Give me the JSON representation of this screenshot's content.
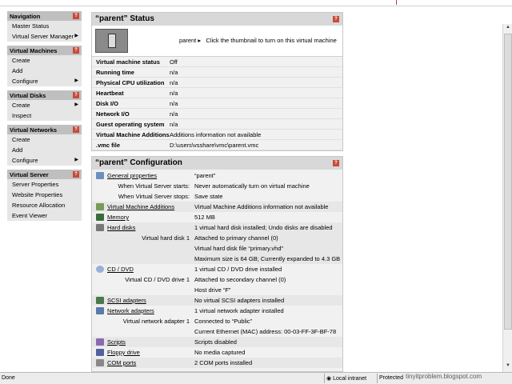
{
  "sidebar": {
    "sections": [
      {
        "title": "Navigation",
        "items": [
          {
            "label": "Master Status",
            "arrow": false
          },
          {
            "label": "Virtual Server Manager",
            "arrow": true
          }
        ]
      },
      {
        "title": "Virtual Machines",
        "items": [
          {
            "label": "Create",
            "arrow": false
          },
          {
            "label": "Add",
            "arrow": false
          },
          {
            "label": "Configure",
            "arrow": true
          }
        ]
      },
      {
        "title": "Virtual Disks",
        "items": [
          {
            "label": "Create",
            "arrow": true
          },
          {
            "label": "Inspect",
            "arrow": false
          }
        ]
      },
      {
        "title": "Virtual Networks",
        "items": [
          {
            "label": "Create",
            "arrow": false
          },
          {
            "label": "Add",
            "arrow": false
          },
          {
            "label": "Configure",
            "arrow": true
          }
        ]
      },
      {
        "title": "Virtual Server",
        "items": [
          {
            "label": "Server Properties",
            "arrow": false
          },
          {
            "label": "Website Properties",
            "arrow": false
          },
          {
            "label": "Resource Allocation",
            "arrow": false
          },
          {
            "label": "Event Viewer",
            "arrow": false
          }
        ]
      }
    ]
  },
  "status_panel": {
    "title": "“parent” Status",
    "vm_name": "parent",
    "thumb_hint": "Click the thumbnail to turn on this virtual machine",
    "rows": [
      {
        "k": "Virtual machine status",
        "v": "Off"
      },
      {
        "k": "Running time",
        "v": "n/a"
      },
      {
        "k": "Physical CPU utilization",
        "v": "n/a"
      },
      {
        "k": "Heartbeat",
        "v": "n/a"
      },
      {
        "k": "Disk I/O",
        "v": "n/a"
      },
      {
        "k": "Network I/O",
        "v": "n/a"
      },
      {
        "k": "Guest operating system",
        "v": "n/a"
      },
      {
        "k": "Virtual Machine Additions",
        "v": "Additions information not available"
      },
      {
        "k": ".vmc file",
        "v": "D:\\users\\vsshare\\vmc\\parent.vmc"
      }
    ]
  },
  "config_panel": {
    "title": "“parent” Configuration",
    "rows": [
      {
        "k": "General properties",
        "v": "“parent”",
        "link": true,
        "icon": "general-properties-icon",
        "shade": false
      },
      {
        "k": "When Virtual Server starts:",
        "v": "Never automatically turn on virtual machine",
        "link": false,
        "icon": "",
        "shade": false
      },
      {
        "k": "When Virtual Server stops:",
        "v": "Save state",
        "link": false,
        "icon": "",
        "shade": false
      },
      {
        "k": "Virtual Machine Additions",
        "v": "Virtual Machine Additions information not available",
        "link": true,
        "icon": "additions-icon",
        "shade": true
      },
      {
        "k": "Memory",
        "v": "512 MB",
        "link": true,
        "icon": "memory-icon",
        "shade": false
      },
      {
        "k": "Hard disks",
        "v": "1 virtual hard disk installed; Undo disks are disabled",
        "link": true,
        "icon": "hard-disk-icon",
        "shade": true
      },
      {
        "k": "Virtual hard disk 1",
        "v": "Attached to primary channel (0)",
        "link": false,
        "icon": "",
        "shade": true
      },
      {
        "k": "",
        "v": "Virtual hard disk file “primary.vhd”",
        "link": false,
        "icon": "",
        "shade": true
      },
      {
        "k": "",
        "v": "Maximum size is 64 GB; Currently expanded to 4.3 GB",
        "link": false,
        "icon": "",
        "shade": true
      },
      {
        "k": "CD / DVD",
        "v": "1 virtual CD / DVD drive installed",
        "link": true,
        "icon": "cd-dvd-icon",
        "shade": false
      },
      {
        "k": "Virtual CD / DVD drive 1",
        "v": "Attached to secondary channel (0)",
        "link": false,
        "icon": "",
        "shade": false
      },
      {
        "k": "",
        "v": "Host drive “F”",
        "link": false,
        "icon": "",
        "shade": false
      },
      {
        "k": "SCSI adapters",
        "v": "No virtual SCSI adapters installed",
        "link": true,
        "icon": "scsi-icon",
        "shade": true
      },
      {
        "k": "Network adapters",
        "v": "1 virtual network adapter installed",
        "link": true,
        "icon": "network-icon",
        "shade": false
      },
      {
        "k": "Virtual network adapter 1",
        "v": "Connected to “Public”",
        "link": false,
        "icon": "",
        "shade": false
      },
      {
        "k": "",
        "v": "Current Ethernet (MAC) address: 00-03-FF-3F-BF-78",
        "link": false,
        "icon": "",
        "shade": false
      },
      {
        "k": "Scripts",
        "v": "Scripts disabled",
        "link": true,
        "icon": "scripts-icon",
        "shade": true
      },
      {
        "k": "Floppy drive",
        "v": "No media captured",
        "link": true,
        "icon": "floppy-icon",
        "shade": false
      },
      {
        "k": "COM ports",
        "v": "2 COM ports installed",
        "link": true,
        "icon": "com-port-icon",
        "shade": true
      }
    ]
  },
  "statusbar": {
    "left": "Done",
    "zone": "Local intranet",
    "protected": "Protected"
  },
  "watermark": "tinyitproblem.blogspot.com",
  "help_glyph": "?"
}
